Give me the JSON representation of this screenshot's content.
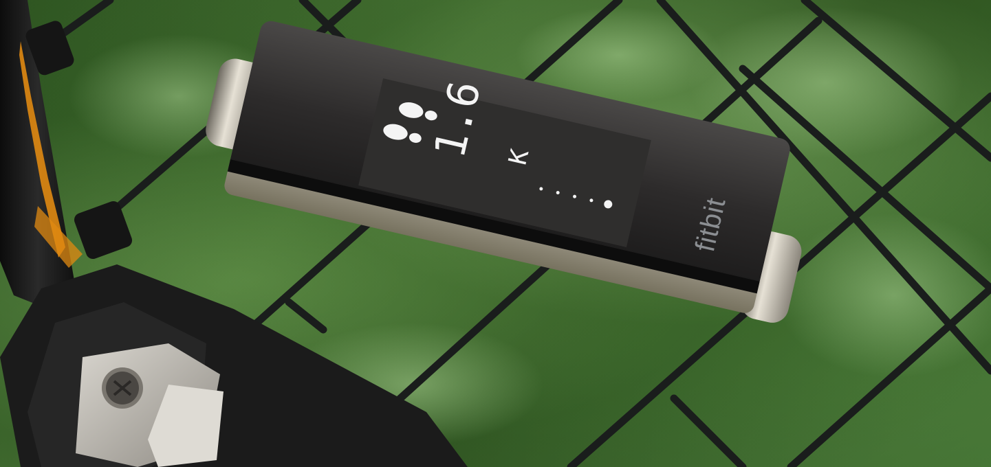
{
  "device": {
    "display": {
      "steps_value": "1.6",
      "steps_unit": "K",
      "progress_dots_total": 5,
      "progress_dots_filled": 1
    },
    "brand": "fitbit"
  },
  "colors": {
    "background_green": "#3c6a2d",
    "fence_wire": "#1a1d1c",
    "device_glass": "#2b2a2a",
    "device_metal": "#a39e90",
    "bike_frame_orange": "#e08a12",
    "screen_pixels": "#f4f4f4"
  },
  "icons": [
    "footsteps-icon"
  ]
}
